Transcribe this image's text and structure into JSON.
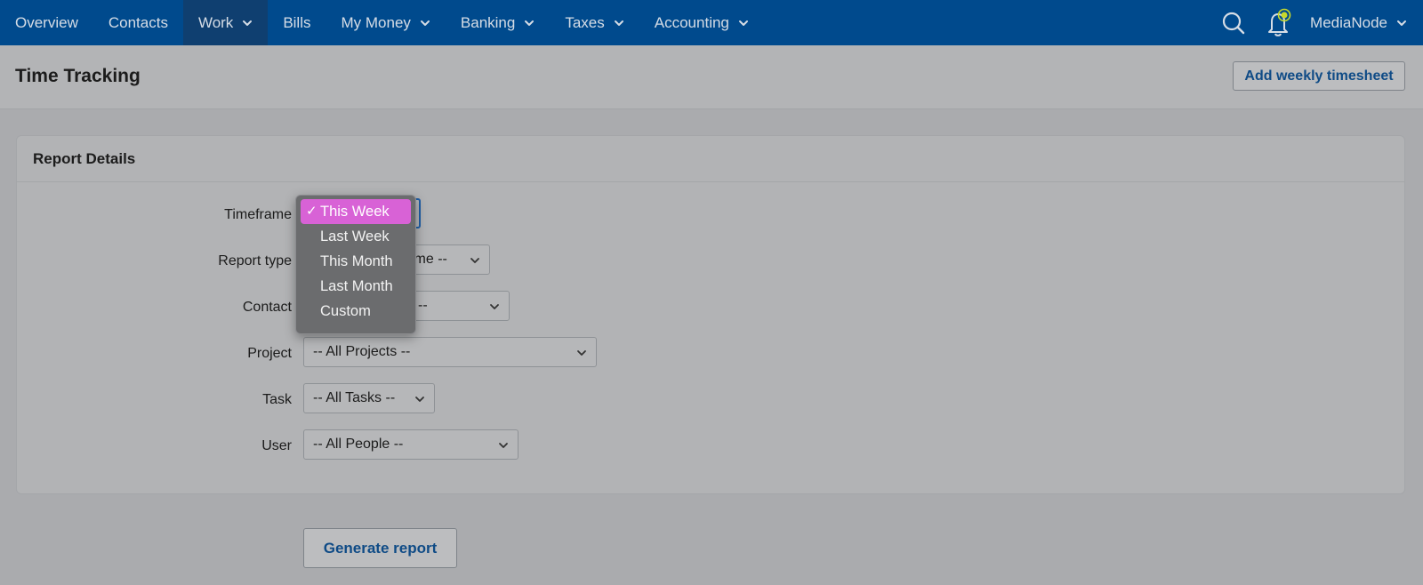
{
  "nav": {
    "items": [
      {
        "label": "Overview",
        "dropdown": false
      },
      {
        "label": "Contacts",
        "dropdown": false
      },
      {
        "label": "Work",
        "dropdown": true,
        "active": true
      },
      {
        "label": "Bills",
        "dropdown": false
      },
      {
        "label": "My Money",
        "dropdown": true
      },
      {
        "label": "Banking",
        "dropdown": true
      },
      {
        "label": "Taxes",
        "dropdown": true
      },
      {
        "label": "Accounting",
        "dropdown": true
      }
    ],
    "account": "MediaNode",
    "icons": [
      "search-icon",
      "bell-icon"
    ]
  },
  "header": {
    "title": "Time Tracking",
    "add_button": "Add weekly timesheet"
  },
  "report": {
    "title": "Report Details",
    "fields": {
      "timeframe": {
        "label": "Timeframe",
        "value": "This Week"
      },
      "report_type": {
        "label": "Report type",
        "value_visible": "ime --"
      },
      "contact": {
        "label": "Contact",
        "value_visible": "--"
      },
      "project": {
        "label": "Project",
        "value": "-- All Projects --"
      },
      "task": {
        "label": "Task",
        "value": "-- All Tasks --"
      },
      "user": {
        "label": "User",
        "value": "-- All People --"
      }
    }
  },
  "timeframe_menu": {
    "options": [
      "This Week",
      "Last Week",
      "This Month",
      "Last Month",
      "Custom"
    ],
    "selected": "This Week",
    "check": "✓"
  },
  "actions": {
    "generate": "Generate report"
  },
  "colors": {
    "nav_bg": "#004a8d",
    "accent": "#0f4b86",
    "menu_highlight": "#d862d6",
    "notification_dot": "#c7d92b"
  }
}
